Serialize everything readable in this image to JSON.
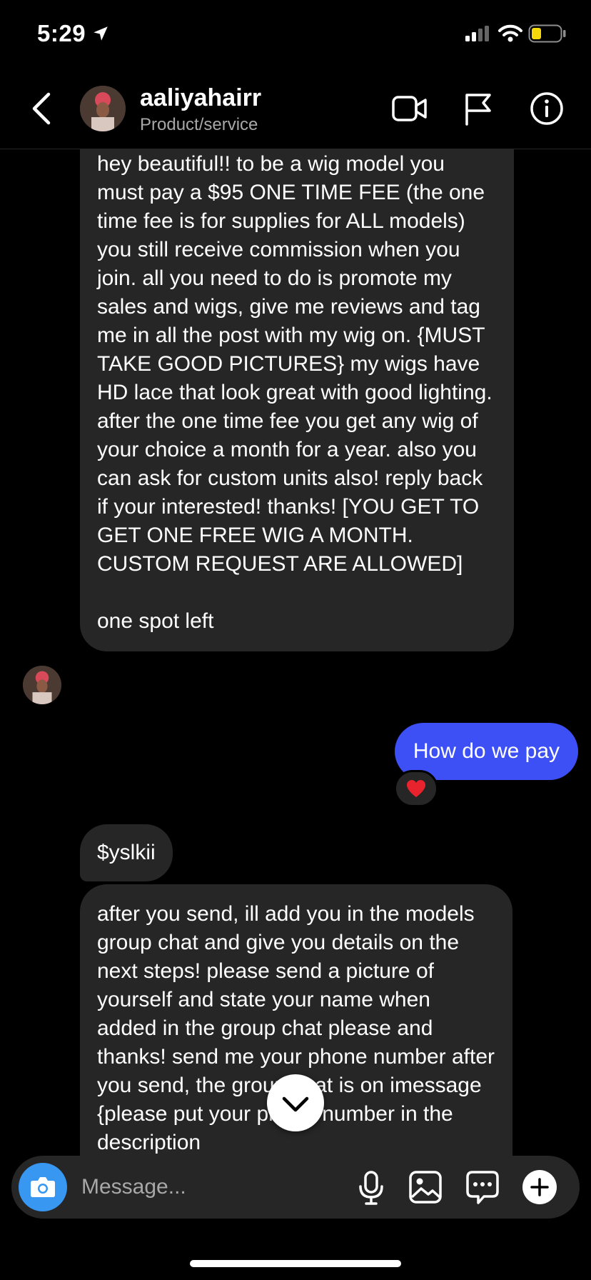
{
  "status_bar": {
    "time": "5:29"
  },
  "header": {
    "username": "aaliyahairr",
    "subtitle": "Product/service",
    "icons": [
      "back-icon",
      "video-call-icon",
      "flag-icon",
      "info-icon"
    ]
  },
  "messages": {
    "msg1_text": "hey beautiful!! to be a wig model you must pay a $95 ONE TIME FEE (the one time fee is for supplies for ALL models) you still receive commission when you join. all you need to do is promote my sales and wigs, give me reviews and tag me in all the post with my wig on. {MUST TAKE GOOD PICTURES} my wigs have HD lace that look great with good lighting. after the one time fee you get any wig of your choice a month for a year. also you can ask for custom units also! reply back if your interested! thanks! [YOU GET TO GET ONE FREE WIG A MONTH. CUSTOM REQUEST ARE ALLOWED]",
    "msg1_tail": "one spot left",
    "outgoing_text": "How do we pay",
    "reaction": "❤️",
    "msg2_text": "$yslkii",
    "msg3_text": "after you send, ill add you in the models group chat and give you details on the next steps! please send a picture of yourself and state your name when added in the group chat please and thanks! send me your phone number after you send, the group chat is on imessage {please put your phone number in the description"
  },
  "composer": {
    "placeholder": "Message...",
    "icons": [
      "camera-icon",
      "microphone-icon",
      "gallery-icon",
      "sticker-icon",
      "plus-icon"
    ]
  },
  "colors": {
    "outgoing_bubble": "#3d50f5",
    "incoming_bubble": "#262626",
    "camera_button": "#3897f0"
  }
}
